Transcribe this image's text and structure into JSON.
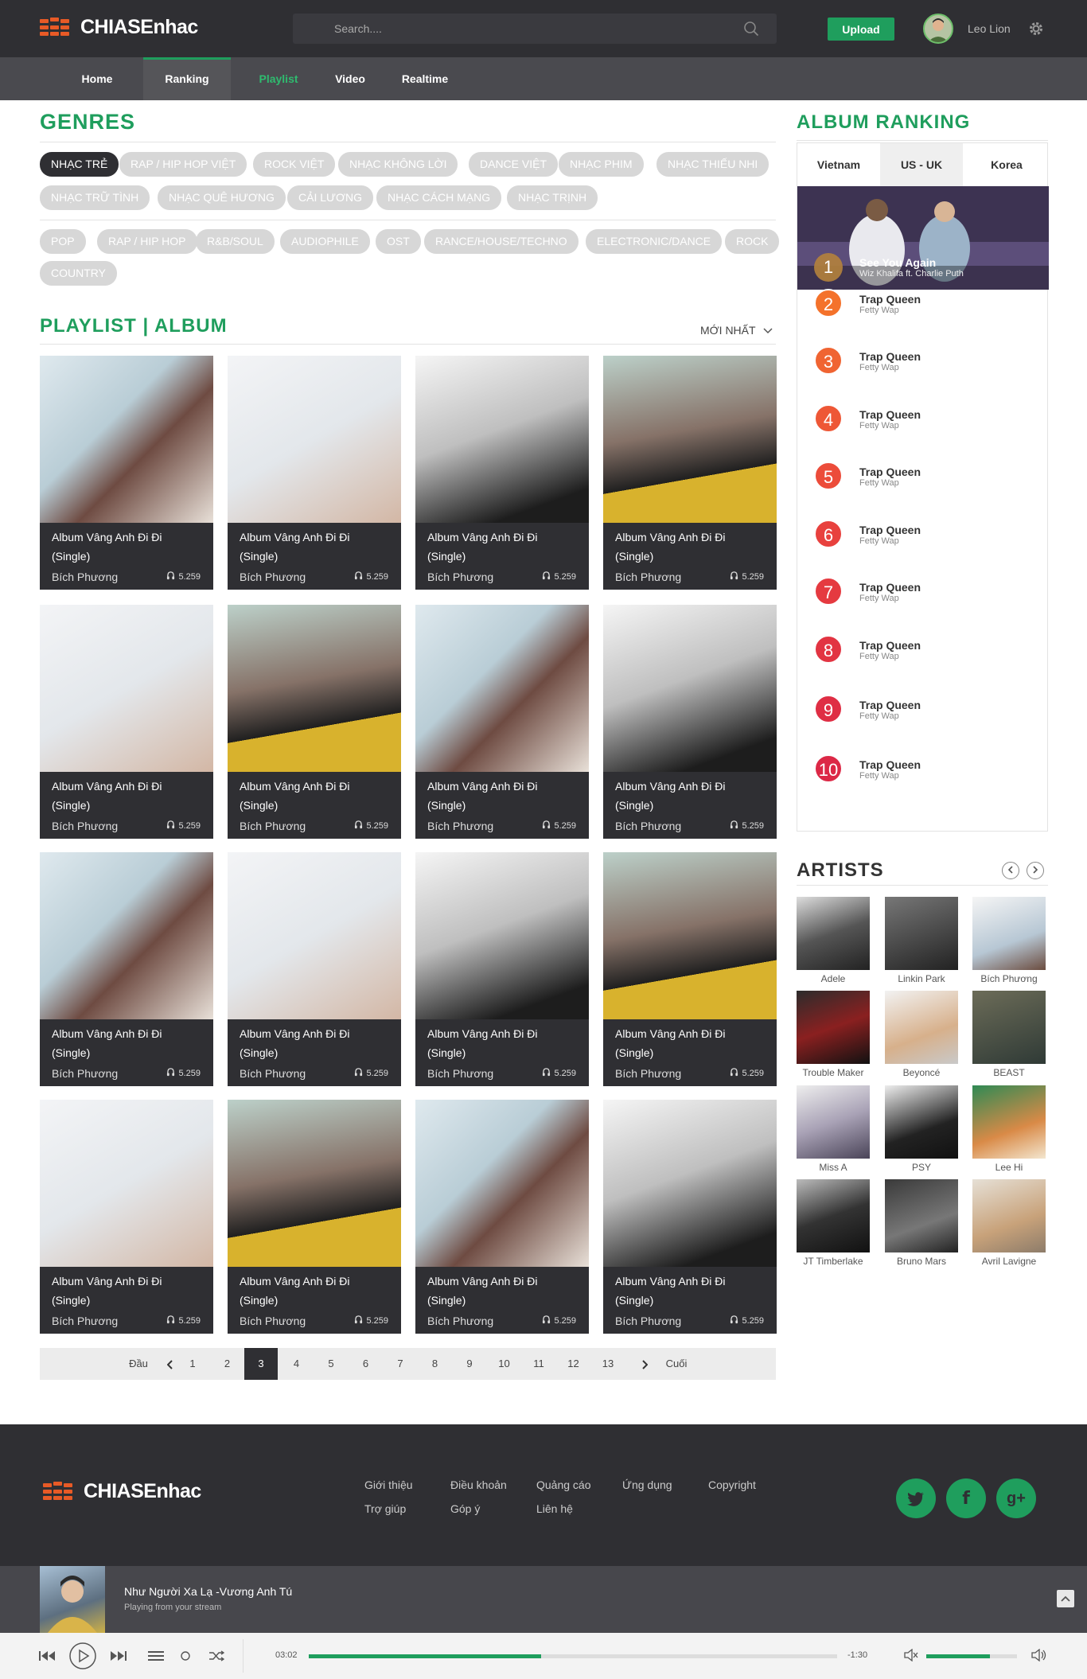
{
  "header": {
    "logo_text": "CHIASEnhac",
    "search_placeholder": "Search....",
    "upload_label": "Upload",
    "username": "Leo Lion"
  },
  "nav": {
    "items": [
      "Home",
      "Ranking",
      "Playlist",
      "Video",
      "Realtime"
    ]
  },
  "genres": {
    "title": "GENRES",
    "row1": [
      "NHẠC TRẺ",
      "RAP / HIP HOP VIỆT",
      "ROCK VIỆT",
      "NHẠC KHÔNG LỜI",
      "DANCE VIỆT",
      "NHẠC PHIM",
      "NHẠC THIẾU NHI"
    ],
    "row2": [
      "NHẠC TRỮ TÌNH",
      "NHẠC QUÊ HƯƠNG",
      "CẢI LƯƠNG",
      "NHẠC CÁCH MẠNG",
      "NHẠC TRỊNH"
    ],
    "row3": [
      "POP",
      "RAP / HIP HOP",
      "R&B/SOUL",
      "AUDIOPHILE",
      "OST",
      "RANCE/HOUSE/TECHNO",
      "ELECTRONIC/DANCE",
      "ROCK"
    ],
    "row4": [
      "COUNTRY"
    ]
  },
  "playlist": {
    "title": "PLAYLIST | ALBUM",
    "sort_label": "MỚI NHẤT",
    "card_title_line1": "Album Vâng Anh Đi Đi",
    "card_title_line2": "(Single)",
    "card_artist": "Bích Phương",
    "card_plays": "5.259"
  },
  "pagination": {
    "first": "Đầu",
    "last": "Cuối",
    "pages": [
      "1",
      "2",
      "3",
      "4",
      "5",
      "6",
      "7",
      "8",
      "9",
      "10",
      "11",
      "12",
      "13"
    ],
    "current": "3"
  },
  "album_ranking": {
    "title": "ALBUM RANKING",
    "tabs": [
      "Vietnam",
      "US - UK",
      "Korea"
    ],
    "hero": {
      "rank": "1",
      "title": "See You Again",
      "artist": "Wiz Khalifa ft. Charlie Puth"
    },
    "items": [
      {
        "rank": "2",
        "title": "Trap Queen",
        "artist": "Fetty Wap"
      },
      {
        "rank": "3",
        "title": "Trap Queen",
        "artist": "Fetty Wap"
      },
      {
        "rank": "4",
        "title": "Trap Queen",
        "artist": "Fetty Wap"
      },
      {
        "rank": "5",
        "title": "Trap Queen",
        "artist": "Fetty Wap"
      },
      {
        "rank": "6",
        "title": "Trap Queen",
        "artist": "Fetty Wap"
      },
      {
        "rank": "7",
        "title": "Trap Queen",
        "artist": "Fetty Wap"
      },
      {
        "rank": "8",
        "title": "Trap Queen",
        "artist": "Fetty Wap"
      },
      {
        "rank": "9",
        "title": "Trap Queen",
        "artist": "Fetty Wap"
      },
      {
        "rank": "10",
        "title": "Trap Queen",
        "artist": "Fetty Wap"
      }
    ]
  },
  "artists": {
    "title": "ARTISTS",
    "names": [
      "Adele",
      "Linkin Park",
      "Bích Phương",
      "Trouble Maker",
      "Beyoncé",
      "BEAST",
      "Miss A",
      "PSY",
      "Lee Hi",
      "JT Timberlake",
      "Bruno Mars",
      "Avril Lavigne"
    ]
  },
  "footer": {
    "logo_text": "CHIASEnhac",
    "links": [
      "Giới thiệu",
      "Điều khoản",
      "Quảng cáo",
      "Ứng dụng",
      "Copyright",
      "Trợ giúp",
      "Góp ý",
      "Liên hệ"
    ]
  },
  "player": {
    "song": "Như Người Xa Lạ -Vương Anh Tú",
    "subtitle": "Playing from your stream",
    "elapsed": "03:02",
    "remaining": "-1:30",
    "progress": 0.44,
    "volume": 0.7
  },
  "colors": {
    "accent": "#1f9e5d",
    "dark": "#2f2f33",
    "logo_orange": "#e85a26"
  }
}
